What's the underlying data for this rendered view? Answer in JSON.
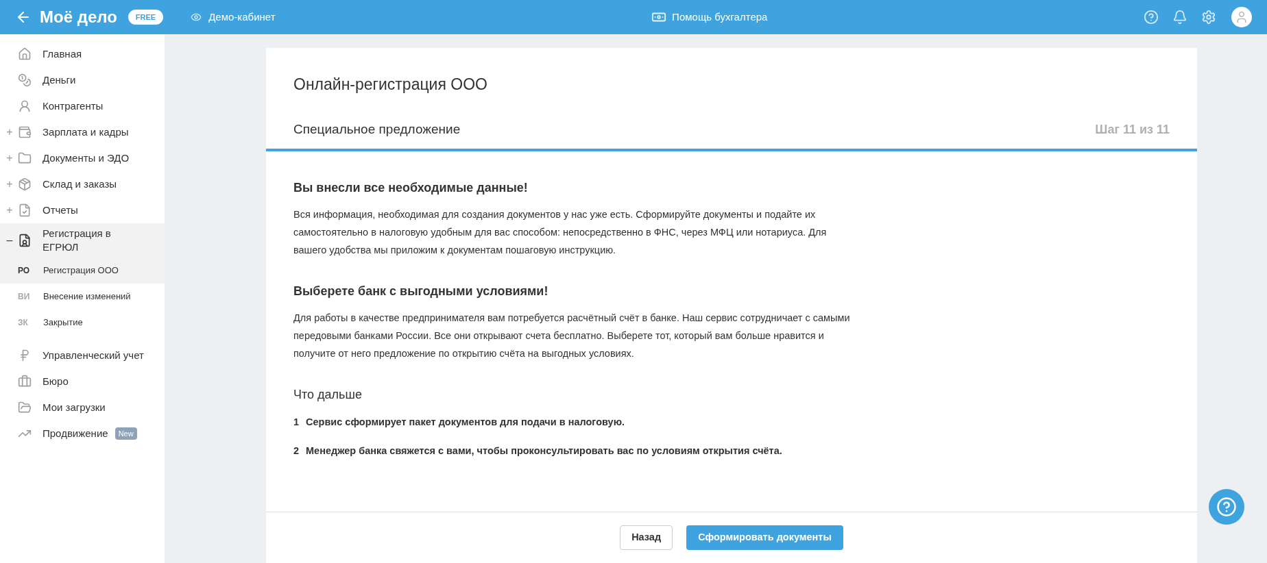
{
  "header": {
    "logo": "Моё дело",
    "plan_badge": "FREE",
    "demo_link": "Демо-кабинет",
    "assistant_link": "Помощь бухгалтера"
  },
  "sidebar": {
    "items": [
      {
        "label": "Главная"
      },
      {
        "label": "Деньги"
      },
      {
        "label": "Контрагенты"
      },
      {
        "label": "Зарплата и кадры",
        "expanded": false,
        "toggle": "+"
      },
      {
        "label": "Документы и ЭДО",
        "expanded": false,
        "toggle": "+"
      },
      {
        "label": "Склад и заказы",
        "expanded": false,
        "toggle": "+"
      },
      {
        "label": "Отчеты",
        "expanded": false,
        "toggle": "+"
      },
      {
        "label": "Регистрация в ЕГРЮЛ",
        "expanded": true,
        "toggle": "–",
        "children": [
          {
            "abbr": "РО",
            "label": "Регистрация ООО",
            "selected": true
          },
          {
            "abbr": "ВИ",
            "label": "Внесение изменений",
            "selected": false
          },
          {
            "abbr": "ЗК",
            "label": "Закрытие",
            "selected": false
          }
        ]
      },
      {
        "label": "Управленческий учет"
      },
      {
        "label": "Бюро"
      },
      {
        "label": "Мои загрузки"
      },
      {
        "label": "Продвижение",
        "badge": "New"
      }
    ]
  },
  "card": {
    "title": "Онлайн-регистрация ООО",
    "step_title": "Специальное предложение",
    "step_counter": "Шаг 11 из 11",
    "sections": [
      {
        "heading": "Вы внесли все необходимые данные!",
        "text": "Вся информация, необходимая для создания документов у нас уже есть. Сформируйте документы и подайте их самостоятельно в налоговую удобным для вас способом: непосредственно в ФНС, через МФЦ или нотариуса. Для вашего удобства мы приложим к документам пошаговую инструкцию."
      },
      {
        "heading": "Выберете банк с выгодными условиями!",
        "text": "Для работы в качестве предпринимателя вам потребуется расчётный счёт в банке. Наш сервис сотрудничает с самыми передовыми банками России. Все они открывают счета бесплатно. Выберете тот, который вам больше нравится и получите от него предложение по открытию счёта на выгодных условиях."
      }
    ],
    "next_heading": "Что дальше",
    "next_steps": [
      {
        "number": "1",
        "text": "Сервис сформирует пакет документов для подачи в налоговую."
      },
      {
        "number": "2",
        "text": "Менеджер банка свяжется с вами, чтобы проконсультировать вас по условиям открытия счёта."
      }
    ],
    "buttons": [
      {
        "label": "Назад",
        "kind": "secondary"
      },
      {
        "label": "Сформировать документы",
        "kind": "primary"
      }
    ]
  }
}
